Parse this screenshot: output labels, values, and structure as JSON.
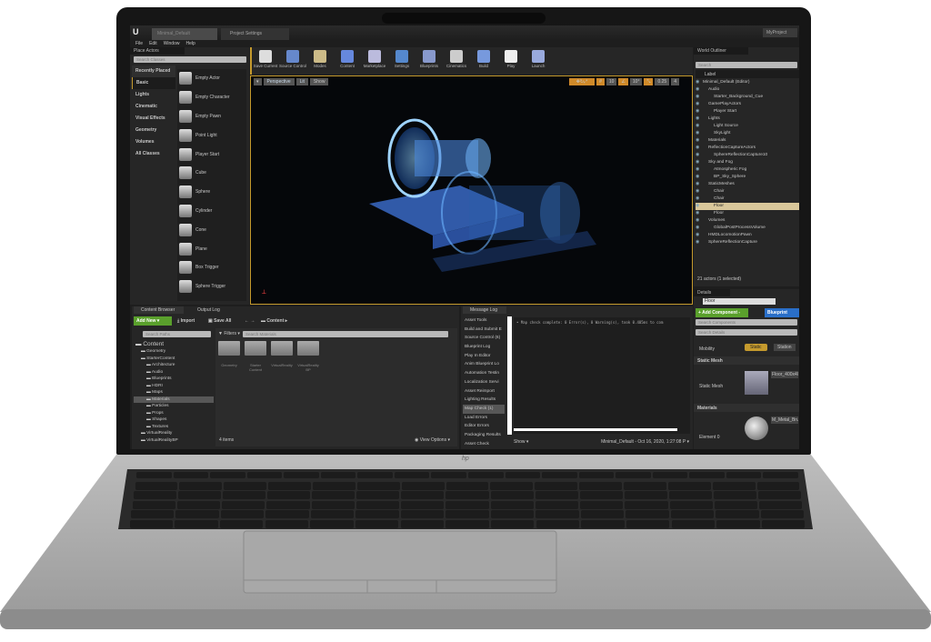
{
  "window": {
    "tabs": [
      "Minimal_Default",
      "Project Settings"
    ],
    "project": "MyProject"
  },
  "menu": [
    "File",
    "Edit",
    "Window",
    "Help"
  ],
  "place_actors": {
    "title": "Place Actors",
    "search_placeholder": "Search Classes",
    "categories": [
      "Recently Placed",
      "Basic",
      "Lights",
      "Cinematic",
      "Visual Effects",
      "Geometry",
      "Volumes",
      "All Classes"
    ],
    "selected_category": "Basic",
    "items": [
      "Empty Actor",
      "Empty Character",
      "Empty Pawn",
      "Point Light",
      "Player Start",
      "Cube",
      "Sphere",
      "Cylinder",
      "Cone",
      "Plane",
      "Box Trigger",
      "Sphere Trigger"
    ]
  },
  "toolbar": {
    "buttons": [
      "Save Current",
      "Source Control",
      "Modes",
      "Content",
      "Marketplace",
      "Settings",
      "Blueprints",
      "Cinematics",
      "Build",
      "Play",
      "Launch"
    ]
  },
  "viewport": {
    "perspective": "Perspective",
    "lit": "Lit",
    "show": "Show",
    "snap_grid": "10",
    "snap_rot": "10°",
    "snap_scale": "0.25",
    "cam_speed": "4"
  },
  "outliner": {
    "title": "World Outliner",
    "search_placeholder": "Search",
    "label_header": "Label",
    "items": [
      {
        "t": "Minimal_Default (Editor)",
        "d": 0
      },
      {
        "t": "Audio",
        "d": 1
      },
      {
        "t": "Starter_Background_Cue",
        "d": 2
      },
      {
        "t": "GamePlayActors",
        "d": 1
      },
      {
        "t": "Player Start",
        "d": 2
      },
      {
        "t": "Lights",
        "d": 1
      },
      {
        "t": "Light Source",
        "d": 2
      },
      {
        "t": "SkyLight",
        "d": 2
      },
      {
        "t": "Materials",
        "d": 1
      },
      {
        "t": "ReflectionCaptureActors",
        "d": 1
      },
      {
        "t": "SphereReflectionCapture10",
        "d": 2
      },
      {
        "t": "Sky and Fog",
        "d": 1
      },
      {
        "t": "Atmospheric Fog",
        "d": 2
      },
      {
        "t": "BP_Sky_Sphere",
        "d": 2
      },
      {
        "t": "StaticMeshes",
        "d": 1
      },
      {
        "t": "Chair",
        "d": 2
      },
      {
        "t": "Chair",
        "d": 2
      },
      {
        "t": "Floor",
        "d": 2,
        "sel": true
      },
      {
        "t": "Floor",
        "d": 2
      },
      {
        "t": "Volumes",
        "d": 1
      },
      {
        "t": "GlobalPostProcessVolume",
        "d": 2
      },
      {
        "t": "HMDLocomotionPawn",
        "d": 1
      },
      {
        "t": "SphereReflectionCapture",
        "d": 1
      }
    ],
    "status": "21 actors (1 selected)"
  },
  "details": {
    "title": "Details",
    "name": "Floor",
    "add_component": "+ Add Component -",
    "blueprint": "Blueprint",
    "search_components": "Search Components",
    "search_details": "Search Details",
    "mobility_label": "Mobility",
    "mobility_static": "Static",
    "mobility_stationary": "Station",
    "static_mesh_section": "Static Mesh",
    "static_mesh_label": "Static Mesh",
    "static_mesh_value": "Floor_400x400",
    "materials_section": "Materials",
    "element0_label": "Element 0",
    "element0_value": "M_Metal_Brus"
  },
  "content_browser": {
    "tabs": [
      "Content Browser",
      "Output Log"
    ],
    "add_new": "Add New",
    "import": "Import",
    "save_all": "Save All",
    "path": "Content",
    "search_paths": "Search Paths",
    "filters": "Filters",
    "search_assets": "Search Materials",
    "tree": [
      {
        "t": "Content",
        "d": 0
      },
      {
        "t": "Geometry",
        "d": 1
      },
      {
        "t": "StarterContent",
        "d": 1
      },
      {
        "t": "Architecture",
        "d": 2
      },
      {
        "t": "Audio",
        "d": 2
      },
      {
        "t": "Blueprints",
        "d": 2
      },
      {
        "t": "HDRI",
        "d": 2
      },
      {
        "t": "Maps",
        "d": 2
      },
      {
        "t": "Materials",
        "d": 2,
        "sel": true
      },
      {
        "t": "Particles",
        "d": 2
      },
      {
        "t": "Props",
        "d": 2
      },
      {
        "t": "Shapes",
        "d": 2
      },
      {
        "t": "Textures",
        "d": 2
      },
      {
        "t": "VirtualReality",
        "d": 1
      },
      {
        "t": "VirtualRealityBP",
        "d": 1
      }
    ],
    "folders": [
      "Geometry",
      "Starter Content",
      "VirtualReality",
      "VirtualReality BP"
    ],
    "count": "4 items",
    "view_options": "View Options"
  },
  "message_log": {
    "title": "Message Log",
    "categories": [
      "Asset Tools",
      "Build and Submit E",
      "Source Control (6)",
      "Blueprint Log",
      "Play In Editor",
      "Anim Blueprint Lo",
      "Automation Testin",
      "Localization Servi",
      "Asset Reimport",
      "Lighting Results",
      "Map Check (1)",
      "Load Errors",
      "Editor Errors",
      "Packaging Results",
      "Asset Check"
    ],
    "selected": "Map Check (1)",
    "message": "• Map check complete: 0 Error(s), 0 Warning(s), took 0.405ms to com",
    "show": "Show",
    "footer": "Minimal_Default - Oct 16, 2020, 1:27:08 P"
  },
  "brand": {
    "logo": "hp"
  },
  "colors": {
    "add_new": "#5aa02c",
    "blueprint": "#2a6fc9",
    "selected_outliner": "#d9c79a",
    "viewport_border": "#c59a2d"
  }
}
